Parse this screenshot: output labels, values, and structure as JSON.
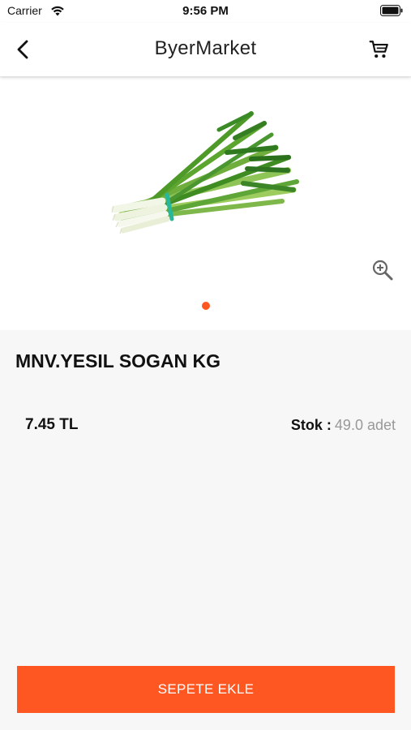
{
  "status_bar": {
    "carrier": "Carrier",
    "time": "9:56 PM",
    "icons": [
      "wifi-icon",
      "battery-icon"
    ]
  },
  "nav": {
    "title": "ByerMarket",
    "icons": [
      "back-chevron-icon",
      "shopping-cart-icon"
    ]
  },
  "product": {
    "image": "green-onion-bunch",
    "name": "MNV.YESIL SOGAN KG",
    "price": "7.45 TL",
    "stock_label": "Stok :",
    "stock_value": "49.0 adet",
    "gallery_pages": 1,
    "gallery_current": 1
  },
  "actions": {
    "add_to_cart_label": "SEPETE EKLE",
    "zoom_icon": "zoom-in-icon"
  },
  "colors": {
    "accent": "#ff5722",
    "background": "#f7f7f7",
    "stock_value": "#999999"
  }
}
